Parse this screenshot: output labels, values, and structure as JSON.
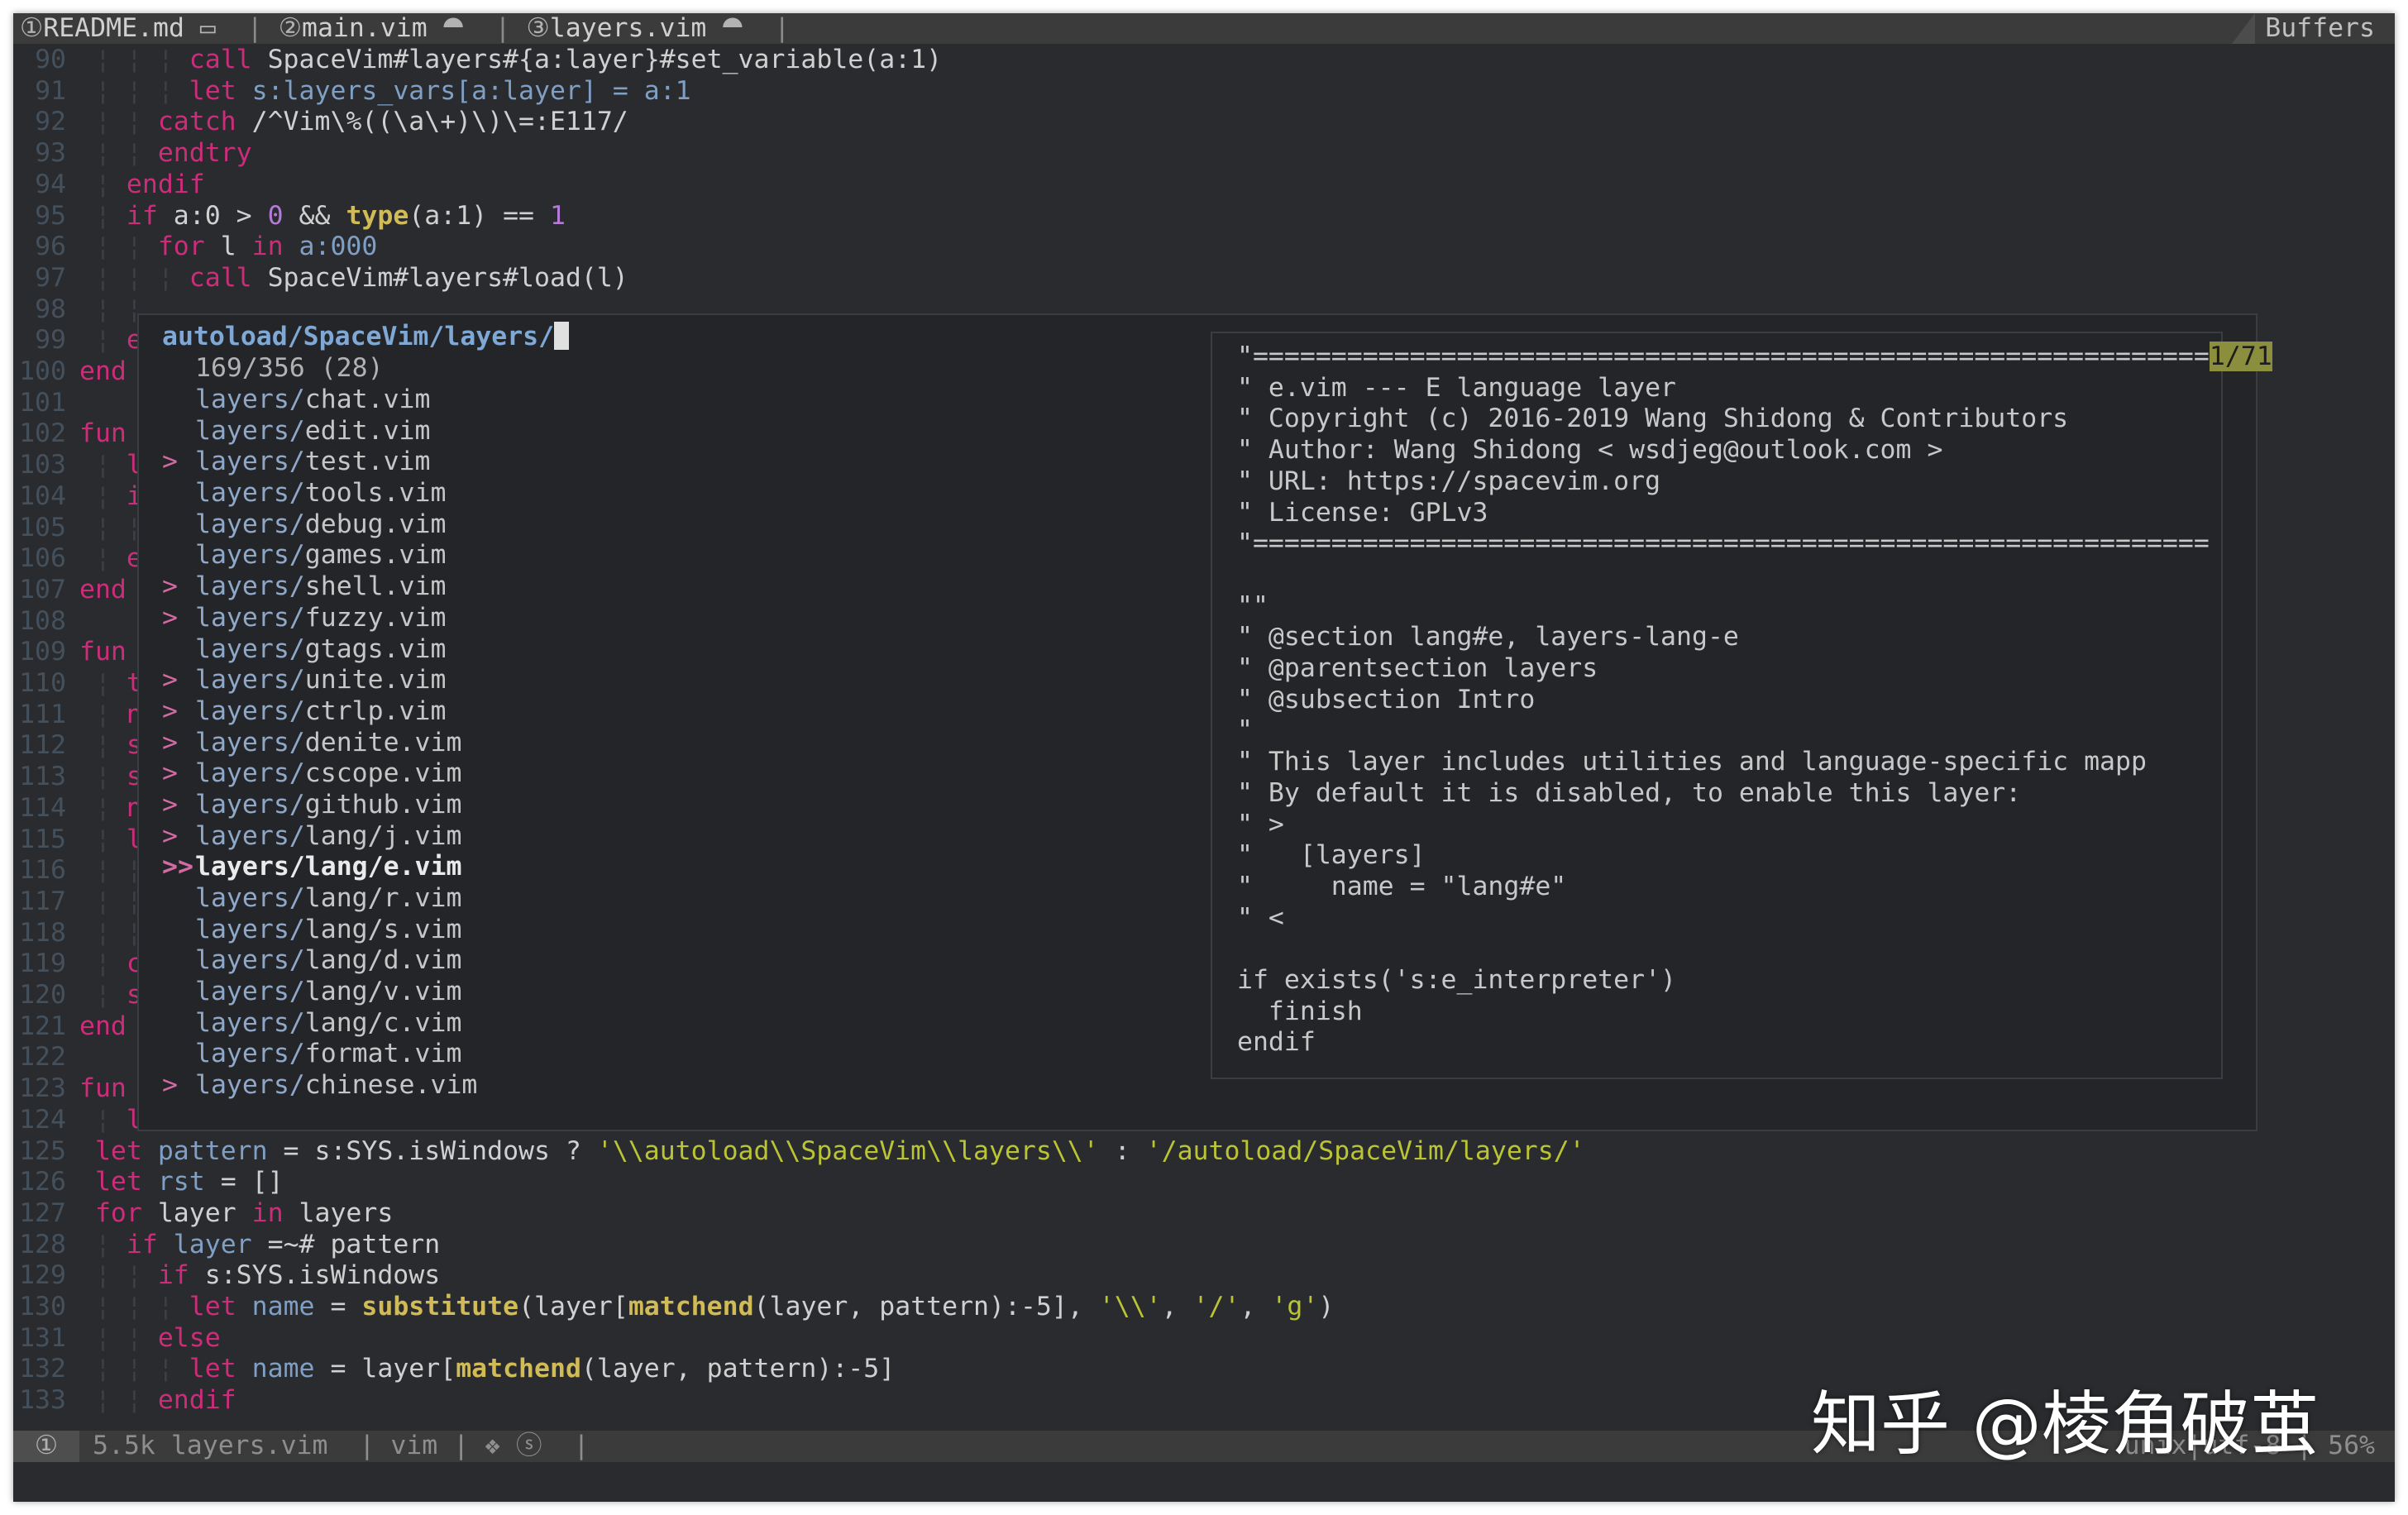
{
  "tabline": {
    "tabs": [
      {
        "num": "①",
        "name": "README.md",
        "icon": " ▭ "
      },
      {
        "num": "②",
        "name": "main.vim",
        "icon": " ⯊ "
      },
      {
        "num": "③",
        "name": "layers.vim",
        "icon": " ⯊ "
      }
    ],
    "separator": "|",
    "buffers_label": "Buffers"
  },
  "editor": {
    "lines": [
      {
        "n": "90",
        "indent": " ¦ ¦ ¦ ",
        "code": [
          {
            "t": "call",
            "c": "kw"
          },
          {
            "t": " SpaceVim#layers#{a:layer}#set_variable(a:1)",
            "c": "fn"
          }
        ]
      },
      {
        "n": "91",
        "indent": " ¦ ¦ ¦ ",
        "code": [
          {
            "t": "let",
            "c": "kw"
          },
          {
            "t": " s:layers_vars[a:layer] = a:1",
            "c": "var"
          }
        ]
      },
      {
        "n": "92",
        "indent": " ¦ ¦ ",
        "code": [
          {
            "t": "catch",
            "c": "kw"
          },
          {
            "t": " /^Vim\\%((\\a\\+)\\)\\=:E117/",
            "c": "fn"
          }
        ]
      },
      {
        "n": "93",
        "indent": " ¦ ¦ ",
        "code": [
          {
            "t": "endtry",
            "c": "kw"
          }
        ]
      },
      {
        "n": "94",
        "indent": " ¦ ",
        "code": [
          {
            "t": "endif",
            "c": "kw"
          }
        ]
      },
      {
        "n": "95",
        "indent": " ¦ ",
        "code": [
          {
            "t": "if",
            "c": "kw"
          },
          {
            "t": " a:0 > ",
            "c": "fn"
          },
          {
            "t": "0",
            "c": "num2"
          },
          {
            "t": " && ",
            "c": "fn"
          },
          {
            "t": "type",
            "c": "bi"
          },
          {
            "t": "(a:1) == ",
            "c": "fn"
          },
          {
            "t": "1",
            "c": "num2"
          }
        ]
      },
      {
        "n": "96",
        "indent": " ¦ ¦ ",
        "code": [
          {
            "t": "for",
            "c": "kw"
          },
          {
            "t": " l ",
            "c": "fn"
          },
          {
            "t": "in",
            "c": "kw"
          },
          {
            "t": " a:000",
            "c": "var"
          }
        ]
      },
      {
        "n": "97",
        "indent": " ¦ ¦ ¦ ",
        "code": [
          {
            "t": "call",
            "c": "kw"
          },
          {
            "t": " SpaceVim#layers#load(l)",
            "c": "fn"
          }
        ]
      },
      {
        "n": "98",
        "indent": " ¦ ¦ ",
        "code": []
      },
      {
        "n": "99",
        "indent": " ¦ ",
        "code": [
          {
            "t": "e",
            "c": "kw"
          }
        ]
      },
      {
        "n": "100",
        "indent": "",
        "code": [
          {
            "t": "end",
            "c": "kw"
          }
        ]
      },
      {
        "n": "101",
        "indent": "",
        "code": []
      },
      {
        "n": "102",
        "indent": "",
        "code": [
          {
            "t": "fun",
            "c": "kw"
          }
        ]
      },
      {
        "n": "103",
        "indent": " ¦ ",
        "code": [
          {
            "t": "l",
            "c": "kw"
          }
        ]
      },
      {
        "n": "104",
        "indent": " ¦ ",
        "code": [
          {
            "t": "i",
            "c": "kw"
          }
        ]
      },
      {
        "n": "105",
        "indent": " ¦ ¦ ",
        "code": []
      },
      {
        "n": "106",
        "indent": " ¦ ",
        "code": [
          {
            "t": "e",
            "c": "kw"
          }
        ]
      },
      {
        "n": "107",
        "indent": "",
        "code": [
          {
            "t": "end",
            "c": "kw"
          }
        ]
      },
      {
        "n": "108",
        "indent": "",
        "code": []
      },
      {
        "n": "109",
        "indent": "",
        "code": [
          {
            "t": "fun",
            "c": "kw"
          }
        ]
      },
      {
        "n": "110",
        "indent": " ¦ ",
        "code": [
          {
            "t": "t",
            "c": "kw"
          }
        ]
      },
      {
        "n": "111",
        "indent": " ¦ ",
        "code": [
          {
            "t": "n",
            "c": "kw"
          }
        ]
      },
      {
        "n": "112",
        "indent": " ¦ ",
        "code": [
          {
            "t": "s",
            "c": "kw"
          }
        ]
      },
      {
        "n": "113",
        "indent": " ¦ ",
        "code": [
          {
            "t": "s",
            "c": "kw"
          }
        ]
      },
      {
        "n": "114",
        "indent": " ¦ ",
        "code": [
          {
            "t": "n",
            "c": "kw"
          }
        ]
      },
      {
        "n": "115",
        "indent": " ¦ ",
        "code": [
          {
            "t": "l",
            "c": "kw"
          }
        ]
      },
      {
        "n": "116",
        "indent": " ¦ ¦ ",
        "code": []
      },
      {
        "n": "117",
        "indent": " ¦ ¦ ",
        "code": []
      },
      {
        "n": "118",
        "indent": " ¦ ¦ ",
        "code": []
      },
      {
        "n": "119",
        "indent": " ¦ ",
        "code": [
          {
            "t": "c",
            "c": "kw"
          }
        ]
      },
      {
        "n": "120",
        "indent": " ¦ ",
        "code": [
          {
            "t": "s",
            "c": "kw"
          }
        ]
      },
      {
        "n": "121",
        "indent": "",
        "code": [
          {
            "t": "end",
            "c": "kw"
          }
        ]
      },
      {
        "n": "122",
        "indent": "",
        "code": []
      },
      {
        "n": "123",
        "indent": "",
        "code": [
          {
            "t": "fun",
            "c": "kw"
          }
        ]
      },
      {
        "n": "124",
        "indent": " ¦ ",
        "code": [
          {
            "t": "l",
            "c": "kw"
          }
        ]
      },
      {
        "n": "125",
        "indent": " ",
        "code": [
          {
            "t": "let",
            "c": "kw"
          },
          {
            "t": " pattern",
            "c": "var"
          },
          {
            "t": " = s:SYS.isWindows ? ",
            "c": "fn"
          },
          {
            "t": "'\\\\autoload\\\\SpaceVim\\\\layers\\\\'",
            "c": "str"
          },
          {
            "t": " : ",
            "c": "fn"
          },
          {
            "t": "'/autoload/SpaceVim/layers/'",
            "c": "str"
          }
        ]
      },
      {
        "n": "126",
        "indent": " ",
        "code": [
          {
            "t": "let",
            "c": "kw"
          },
          {
            "t": " rst",
            "c": "var"
          },
          {
            "t": " = []",
            "c": "fn"
          }
        ]
      },
      {
        "n": "127",
        "indent": " ",
        "code": [
          {
            "t": "for",
            "c": "kw"
          },
          {
            "t": " layer ",
            "c": "fn"
          },
          {
            "t": "in",
            "c": "kw"
          },
          {
            "t": " layers",
            "c": "fn"
          }
        ]
      },
      {
        "n": "128",
        "indent": " ¦ ",
        "code": [
          {
            "t": "if",
            "c": "kw"
          },
          {
            "t": " layer",
            "c": "var"
          },
          {
            "t": " =~# pattern",
            "c": "fn"
          }
        ]
      },
      {
        "n": "129",
        "indent": " ¦ ¦ ",
        "code": [
          {
            "t": "if",
            "c": "kw"
          },
          {
            "t": " s:SYS.isWindows",
            "c": "fn"
          }
        ]
      },
      {
        "n": "130",
        "indent": " ¦ ¦ ¦ ",
        "code": [
          {
            "t": "let",
            "c": "kw"
          },
          {
            "t": " name",
            "c": "var"
          },
          {
            "t": " = ",
            "c": "fn"
          },
          {
            "t": "substitute",
            "c": "bi"
          },
          {
            "t": "(layer[",
            "c": "fn"
          },
          {
            "t": "matchend",
            "c": "bi"
          },
          {
            "t": "(layer, pattern):-5], ",
            "c": "fn"
          },
          {
            "t": "'\\\\'",
            "c": "str"
          },
          {
            "t": ", ",
            "c": "fn"
          },
          {
            "t": "'/'",
            "c": "str"
          },
          {
            "t": ", ",
            "c": "fn"
          },
          {
            "t": "'g'",
            "c": "str"
          },
          {
            "t": ")",
            "c": "fn"
          }
        ]
      },
      {
        "n": "131",
        "indent": " ¦ ¦ ",
        "code": [
          {
            "t": "else",
            "c": "kw"
          }
        ]
      },
      {
        "n": "132",
        "indent": " ¦ ¦ ¦ ",
        "code": [
          {
            "t": "let",
            "c": "kw"
          },
          {
            "t": " name",
            "c": "var"
          },
          {
            "t": " = layer[",
            "c": "fn"
          },
          {
            "t": "matchend",
            "c": "bi"
          },
          {
            "t": "(layer, pattern):-5]",
            "c": "fn"
          }
        ]
      },
      {
        "n": "133",
        "indent": " ¦ ¦ ",
        "code": [
          {
            "t": "endif",
            "c": "kw"
          }
        ]
      }
    ]
  },
  "finder": {
    "prompt_path": "autoload/SpaceVim/layers/",
    "count": "169/356 (28)",
    "items": [
      {
        "mark": " ",
        "pre": "layers/",
        "name": "chat.vim"
      },
      {
        "mark": " ",
        "pre": "layers/",
        "name": "edit.vim"
      },
      {
        "mark": ">",
        "pre": "layers/",
        "name": "test.vim"
      },
      {
        "mark": " ",
        "pre": "layers/",
        "name": "tools.vim"
      },
      {
        "mark": " ",
        "pre": "layers/",
        "name": "debug.vim"
      },
      {
        "mark": " ",
        "pre": "layers/",
        "name": "games.vim"
      },
      {
        "mark": ">",
        "pre": "layers/",
        "name": "shell.vim"
      },
      {
        "mark": ">",
        "pre": "layers/",
        "name": "fuzzy.vim"
      },
      {
        "mark": " ",
        "pre": "layers/",
        "name": "gtags.vim"
      },
      {
        "mark": ">",
        "pre": "layers/",
        "name": "unite.vim"
      },
      {
        "mark": ">",
        "pre": "layers/",
        "name": "ctrlp.vim"
      },
      {
        "mark": ">",
        "pre": "layers/",
        "name": "denite.vim"
      },
      {
        "mark": ">",
        "pre": "layers/",
        "name": "cscope.vim"
      },
      {
        "mark": ">",
        "pre": "layers/",
        "name": "github.vim"
      },
      {
        "mark": ">",
        "pre": "layers/",
        "name": "lang/j.vim"
      },
      {
        "mark": ">>",
        "pre": "layers/",
        "name": "lang/e.vim",
        "selected": true
      },
      {
        "mark": " ",
        "pre": "layers/",
        "name": "lang/r.vim"
      },
      {
        "mark": " ",
        "pre": "layers/",
        "name": "lang/s.vim"
      },
      {
        "mark": " ",
        "pre": "layers/",
        "name": "lang/d.vim"
      },
      {
        "mark": " ",
        "pre": "layers/",
        "name": "lang/v.vim"
      },
      {
        "mark": " ",
        "pre": "layers/",
        "name": "lang/c.vim"
      },
      {
        "mark": " ",
        "pre": "layers/",
        "name": "format.vim"
      },
      {
        "mark": ">",
        "pre": "layers/",
        "name": "chinese.vim"
      }
    ],
    "preview": {
      "position": "1/71",
      "lines": [
        "\"=============================================================",
        "\" e.vim --- E language layer",
        "\" Copyright (c) 2016-2019 Wang Shidong & Contributors",
        "\" Author: Wang Shidong < wsdjeg@outlook.com >",
        "\" URL: https://spacevim.org",
        "\" License: GPLv3",
        "\"=============================================================",
        "",
        "\"\"",
        "\" @section lang#e, layers-lang-e",
        "\" @parentsection layers",
        "\" @subsection Intro",
        "\"",
        "\" This layer includes utilities and language-specific mapp",
        "\" By default it is disabled, to enable this layer:",
        "\" >",
        "\"   [layers]",
        "\"     name = \"lang#e\"",
        "\" <",
        "",
        "if exists('s:e_interpreter')",
        "  finish",
        "endif"
      ]
    }
  },
  "statusline": {
    "mode": "①",
    "info": "5.5k layers.vim  | vim | ❖ ⓢ  |",
    "right": "unix|utf-8 | 56%"
  },
  "watermark": "知乎 @棱角破茧"
}
